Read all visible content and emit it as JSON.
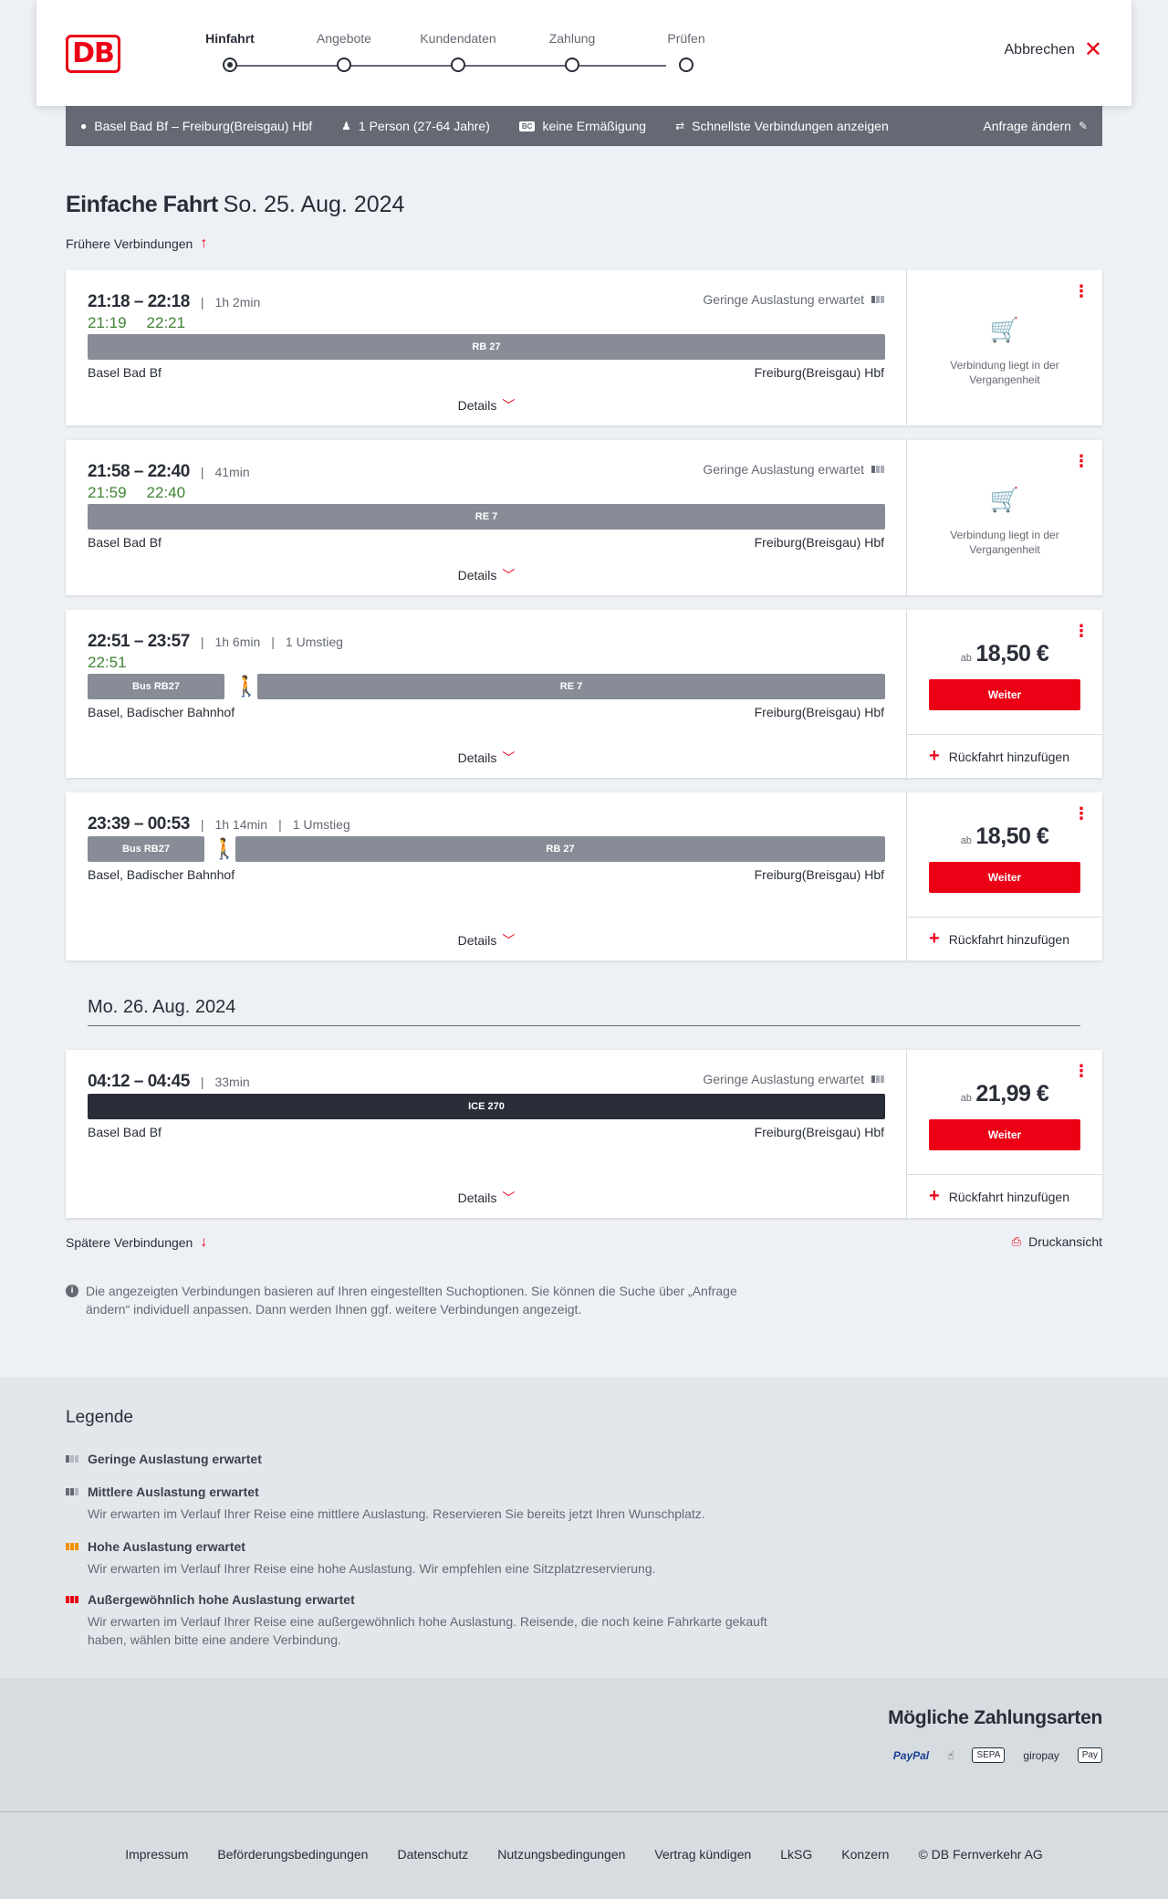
{
  "logo": "DB",
  "stepper": {
    "steps": [
      "Hinfahrt",
      "Angebote",
      "Kundendaten",
      "Zahlung",
      "Prüfen"
    ],
    "active": 0
  },
  "cancel_label": "Abbrechen",
  "search": {
    "route": "Basel Bad Bf – Freiburg(Breisgau) Hbf",
    "persons": "1 Person (27-64 Jahre)",
    "bc_badge": "BC",
    "discount": "keine Ermäßigung",
    "fastest": "Schnellste Verbindungen anzeigen",
    "change": "Anfrage ändern"
  },
  "title": {
    "main": "Einfache Fahrt",
    "date": "So. 25. Aug. 2024"
  },
  "earlier_label": "Frühere Verbindungen",
  "connections": [
    {
      "times": "21:18 – 22:18",
      "duration": "1h 2min",
      "transfers": "",
      "realtime": [
        "21:19",
        "22:21"
      ],
      "load": "Geringe Auslastung erwartet",
      "segments": [
        {
          "label": "RB 27"
        }
      ],
      "from": "Basel Bad Bf",
      "to": "Freiburg(Breisgau) Hbf",
      "details": "Details",
      "status": "Verbindung liegt in der Vergangenheit"
    },
    {
      "times": "21:58 – 22:40",
      "duration": "41min",
      "transfers": "",
      "realtime": [
        "21:59",
        "22:40"
      ],
      "load": "Geringe Auslastung erwartet",
      "segments": [
        {
          "label": "RE 7"
        }
      ],
      "from": "Basel Bad Bf",
      "to": "Freiburg(Breisgau) Hbf",
      "details": "Details",
      "status": "Verbindung liegt in der Vergangenheit"
    },
    {
      "times": "22:51 – 23:57",
      "duration": "1h 6min",
      "transfers": "1 Umstieg",
      "realtime": [
        "22:51"
      ],
      "segments": [
        {
          "label": "Bus RB27"
        },
        {
          "label": "RE 7"
        }
      ],
      "from": "Basel, Badischer Bahnhof",
      "to": "Freiburg(Breisgau) Hbf",
      "details": "Details",
      "price_prefix": "ab",
      "price": "18,50 €",
      "button": "Weiter",
      "return_label": "Rückfahrt hinzufügen"
    },
    {
      "times": "23:39 – 00:53",
      "duration": "1h 14min",
      "transfers": "1 Umstieg",
      "segments": [
        {
          "label": "Bus RB27"
        },
        {
          "label": "RB 27"
        }
      ],
      "from": "Basel, Badischer Bahnhof",
      "to": "Freiburg(Breisgau) Hbf",
      "details": "Details",
      "price_prefix": "ab",
      "price": "18,50 €",
      "button": "Weiter",
      "return_label": "Rückfahrt hinzufügen"
    },
    {
      "times": "04:12 – 04:45",
      "duration": "33min",
      "transfers": "",
      "load": "Geringe Auslastung erwartet",
      "segments": [
        {
          "label": "ICE 270"
        }
      ],
      "from": "Basel Bad Bf",
      "to": "Freiburg(Breisgau) Hbf",
      "details": "Details",
      "price_prefix": "ab",
      "price": "21,99 €",
      "button": "Weiter",
      "return_label": "Rückfahrt hinzufügen"
    }
  ],
  "next_day": "Mo. 26. Aug. 2024",
  "later_label": "Spätere Verbindungen",
  "print_label": "Druckansicht",
  "info_text": "Die angezeigten Verbindungen basieren auf Ihren eingestellten Suchoptionen. Sie können die Suche über „Anfrage ändern“ individuell anpassen. Dann werden Ihnen ggf. weitere Verbindungen angezeigt.",
  "legend": {
    "title": "Legende",
    "items": [
      {
        "label": "Geringe Auslastung erwartet",
        "desc": "",
        "color": "#646973"
      },
      {
        "label": "Mittlere Auslastung erwartet",
        "desc": "Wir erwarten im Verlauf Ihrer Reise eine mittlere Auslastung. Reservieren Sie bereits jetzt Ihren Wunschplatz.",
        "color": "#646973"
      },
      {
        "label": "Hohe Auslastung erwartet",
        "desc": "Wir erwarten im Verlauf Ihrer Reise eine hohe Auslastung. Wir empfehlen eine Sitzplatzreservierung.",
        "color": "#f39200"
      },
      {
        "label": "Außergewöhnlich hohe Auslastung erwartet",
        "desc": "Wir erwarten im Verlauf Ihrer Reise eine außergewöhnlich hohe Auslastung. Reisende, die noch keine Fahrkarte gekauft haben, wählen bitte eine andere Verbindung.",
        "color": "#ec0016"
      }
    ]
  },
  "payment": {
    "title": "Mögliche Zahlungsarten",
    "methods": [
      "PayPal",
      "SEPA",
      "giropay",
      "Pay"
    ]
  },
  "footer": [
    "Impressum",
    "Beförderungsbedingungen",
    "Datenschutz",
    "Nutzungsbedingungen",
    "Vertrag kündigen",
    "LkSG",
    "Konzern",
    "© DB Fernverkehr AG"
  ],
  "colors": {
    "accent": "#ec0016",
    "realtime": "#408335",
    "bar": "#878c96",
    "bar_ice": "#282d37"
  }
}
